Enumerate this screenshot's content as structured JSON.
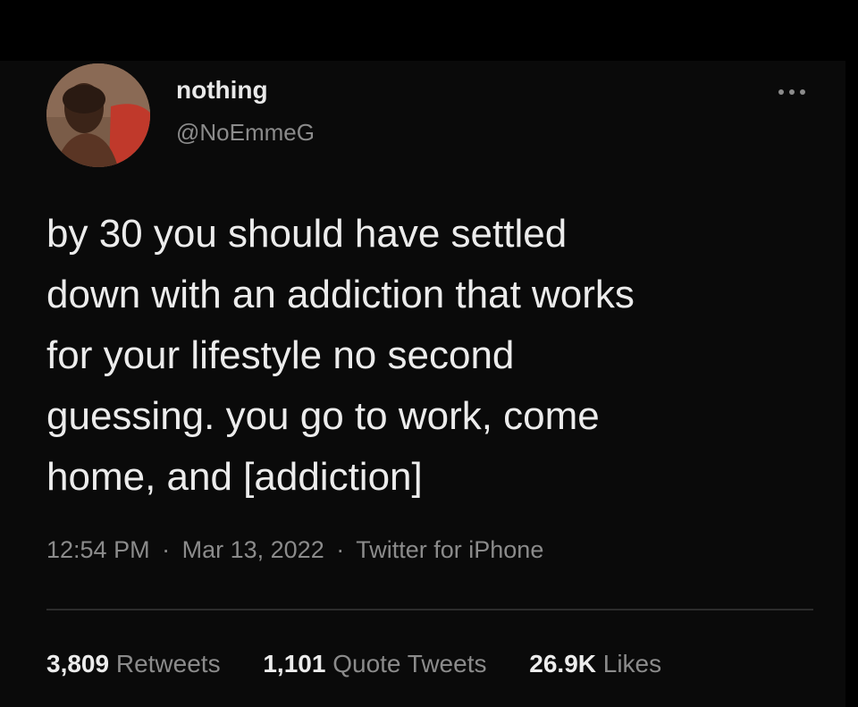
{
  "tweet": {
    "display_name": "nothing",
    "handle": "@NoEmmeG",
    "text": "by 30 you should have settled\ndown with an addiction that works\nfor your lifestyle no second\nguessing. you go to work, come\nhome, and [addiction]",
    "time": "12:54 PM",
    "date": "Mar 13, 2022",
    "source": "Twitter for iPhone",
    "separator": "·"
  },
  "stats": {
    "retweets_count": "3,809",
    "retweets_label": "Retweets",
    "quote_tweets_count": "1,101",
    "quote_tweets_label": "Quote Tweets",
    "likes_count": "26.9K",
    "likes_label": "Likes"
  },
  "icons": {
    "more": "more-dots-icon"
  },
  "colors": {
    "background": "#000000",
    "card": "#0a0a0a",
    "primary_text": "#ececec",
    "secondary_text": "#8b8b8b",
    "divider": "#2c2c2c"
  }
}
